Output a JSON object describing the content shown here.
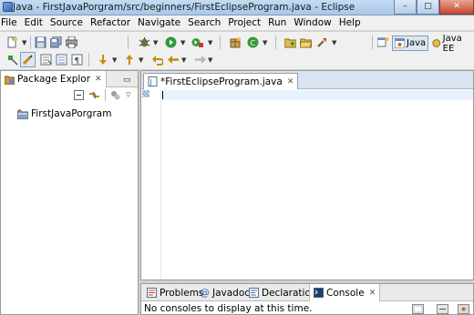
{
  "window": {
    "title": "Java - FirstJavaPorgram/src/beginners/FirstEclipseProgram.java - Eclipse",
    "controls": {
      "minimize": "–",
      "maximize": "□",
      "close": "✕"
    }
  },
  "menubar": {
    "items": [
      "File",
      "Edit",
      "Source",
      "Refactor",
      "Navigate",
      "Search",
      "Project",
      "Run",
      "Window",
      "Help"
    ]
  },
  "perspectives": {
    "items": [
      {
        "label": "Java",
        "active": true
      },
      {
        "label": "Java EE",
        "active": false
      }
    ]
  },
  "package_explorer": {
    "tab_label": "Package Explor",
    "tree": [
      {
        "label": "FirstJavaPorgram",
        "icon": "java-project-icon"
      }
    ]
  },
  "editor": {
    "tab_label": "*FirstEclipseProgram.java",
    "content": ""
  },
  "bottom_panel": {
    "tabs": [
      {
        "label": "Problems",
        "icon": "problems-icon"
      },
      {
        "label": "Javadoc",
        "icon": "javadoc-icon"
      },
      {
        "label": "Declaration",
        "icon": "declaration-icon"
      },
      {
        "label": "Console",
        "icon": "console-icon",
        "selected": true
      }
    ],
    "console_message": "No consoles to display at this time."
  },
  "colors": {
    "titlebar": "#a9c7e8",
    "menubar": "#f0f0f0",
    "editor_tabbar": "#d8e4f2",
    "current_line": "#e8f2fe"
  }
}
